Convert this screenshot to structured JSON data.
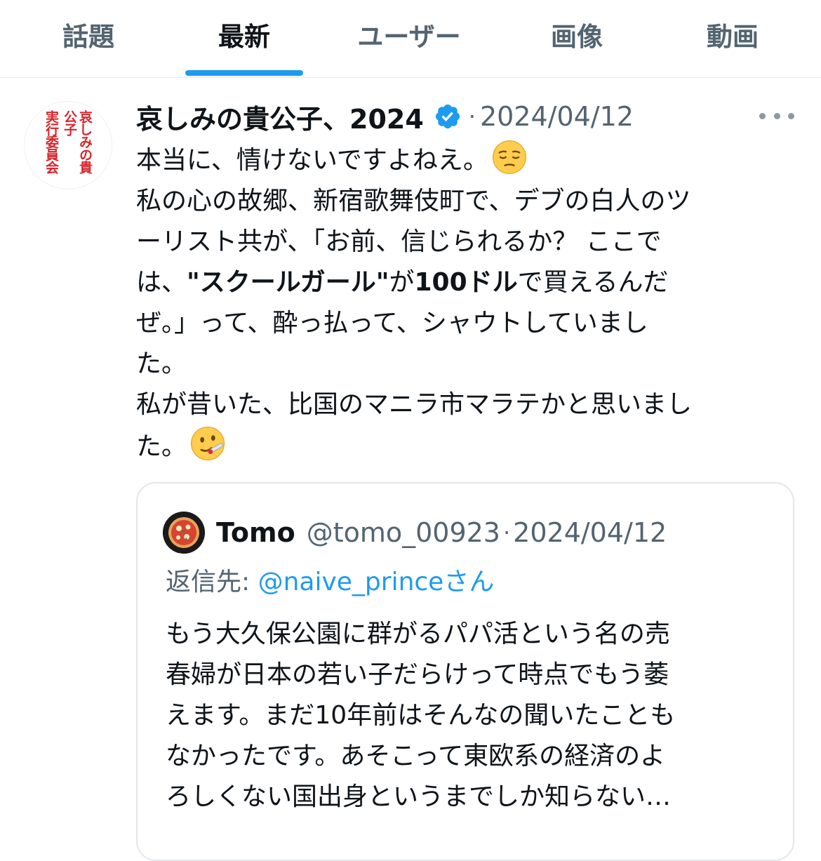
{
  "tabs": [
    {
      "label": "話題",
      "active": false
    },
    {
      "label": "最新",
      "active": true
    },
    {
      "label": "ユーザー",
      "active": false
    },
    {
      "label": "画像",
      "active": false
    },
    {
      "label": "動画",
      "active": false
    }
  ],
  "post": {
    "avatar_text_col1": "哀しみの貴公子",
    "avatar_text_col2": "実行委員会",
    "author_name": "哀しみの貴公子、2024",
    "separator": "·",
    "date": "2024/04/12",
    "lines": {
      "l1": "本当に、情けないですよねえ。",
      "l2": "私の心の故郷、新宿歌舞伎町で、デブの白人のツ",
      "l3": "ーリスト共が、「お前、信じられるか？ ここで",
      "l4_pre": "は、",
      "l4_bold1": "\"スクールガール\"",
      "l4_mid": "が",
      "l4_bold2": "100ドル",
      "l4_post": "で買えるんだ",
      "l5": "ぜ。」って、酔っ払って、シャウトしていまし",
      "l6": "た。",
      "l7": "私が昔いた、比国のマニラ市マラテかと思いまし",
      "l8": "た。"
    },
    "emoji1": "pensive-face",
    "emoji2": "face-with-thermometer"
  },
  "quote": {
    "name": "Tomo",
    "handle": "@tomo_00923",
    "separator": "·",
    "date": "2024/04/12",
    "reply_prefix": "返信先: ",
    "reply_mention": "@naive_prince",
    "reply_suffix": "さん",
    "lines": [
      "もう大久保公園に群がるパパ活という名の売",
      "春婦が日本の若い子だらけって時点でもう萎",
      "えます。まだ10年前はそんなの聞いたことも",
      "なかったです。あそこって東欧系の経済のよ",
      "ろしくない国出身というまでしか知らない…"
    ]
  },
  "colors": {
    "accent": "#1d9bf0",
    "muted": "#536471",
    "text": "#0f1419",
    "stamp_red": "#d8242b"
  }
}
